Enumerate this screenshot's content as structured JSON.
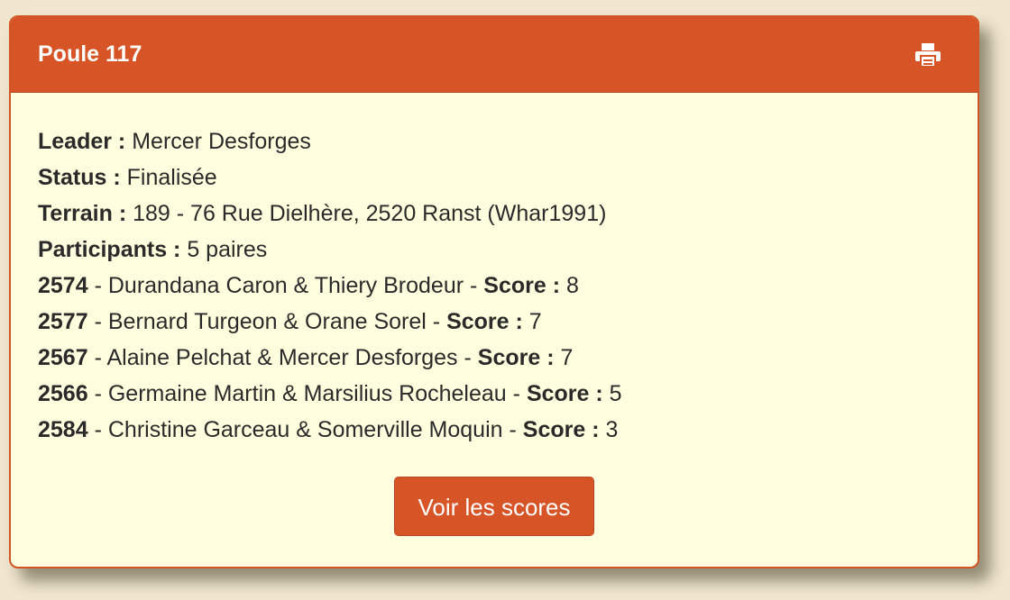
{
  "panel": {
    "title": "Poule 117",
    "print_icon": "print-icon"
  },
  "info": {
    "leader_label": "Leader :",
    "leader_value": "Mercer Desforges",
    "status_label": "Status :",
    "status_value": "Finalisée",
    "terrain_label": "Terrain :",
    "terrain_value": "189 - 76 Rue Dielhère, 2520 Ranst (Whar1991)",
    "participants_label": "Participants :",
    "participants_value": "5 paires"
  },
  "teams": [
    {
      "id": "2574",
      "names": "Durandana Caron & Thiery Brodeur",
      "score_label": "Score :",
      "score": "8"
    },
    {
      "id": "2577",
      "names": "Bernard Turgeon & Orane Sorel",
      "score_label": "Score :",
      "score": "7"
    },
    {
      "id": "2567",
      "names": "Alaine Pelchat & Mercer Desforges",
      "score_label": "Score :",
      "score": "7"
    },
    {
      "id": "2566",
      "names": "Germaine Martin & Marsilius Rocheleau",
      "score_label": "Score :",
      "score": "5"
    },
    {
      "id": "2584",
      "names": "Christine Garceau & Somerville Moquin",
      "score_label": "Score :",
      "score": "3"
    }
  ],
  "separator": "-",
  "actions": {
    "view_scores_label": "Voir les scores"
  },
  "colors": {
    "accent": "#d65425",
    "panel_background": "#ffffe0",
    "page_background": "#efe6cd"
  }
}
